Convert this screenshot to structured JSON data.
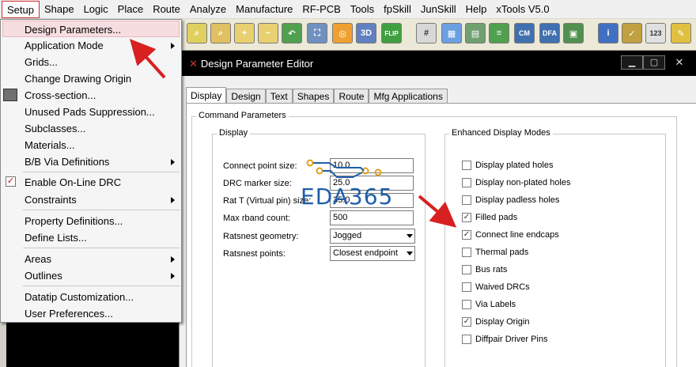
{
  "menubar": {
    "items": [
      "Setup",
      "Shape",
      "Logic",
      "Place",
      "Route",
      "Analyze",
      "Manufacture",
      "RF-PCB",
      "Tools",
      "fpSkill",
      "JunSkill",
      "Help",
      "xTools V5.0"
    ]
  },
  "toolbar": {
    "labels": [
      "3D",
      "FLIP",
      "CM",
      "DFA",
      "123"
    ]
  },
  "menu": {
    "items": [
      {
        "label": "Design Parameters...",
        "sub": false
      },
      {
        "label": "Application Mode",
        "sub": true
      },
      {
        "label": "Grids...",
        "sub": false
      },
      {
        "label": "Change Drawing Origin",
        "sub": false
      },
      {
        "label": "Cross-section...",
        "sub": false
      },
      {
        "label": "Unused Pads Suppression...",
        "sub": false
      },
      {
        "label": "Subclasses...",
        "sub": false
      },
      {
        "label": "Materials...",
        "sub": false
      },
      {
        "label": "B/B Via Definitions",
        "sub": true
      },
      {
        "label": "Enable On-Line DRC",
        "sub": false
      },
      {
        "label": "Constraints",
        "sub": true
      },
      {
        "label": "Property Definitions...",
        "sub": false
      },
      {
        "label": "Define Lists...",
        "sub": false
      },
      {
        "label": "Areas",
        "sub": true
      },
      {
        "label": "Outlines",
        "sub": true
      },
      {
        "label": "Datatip Customization...",
        "sub": false
      },
      {
        "label": "User Preferences...",
        "sub": false
      }
    ]
  },
  "dialog": {
    "title": "Design Parameter Editor",
    "tabs": [
      "Display",
      "Design",
      "Text",
      "Shapes",
      "Route",
      "Mfg Applications"
    ],
    "command_group": "Command Parameters",
    "display_group": "Display",
    "enhanced_group": "Enhanced Display Modes",
    "fields": [
      {
        "label": "Connect point size:",
        "value": "10.0"
      },
      {
        "label": "DRC marker size:",
        "value": "25.0"
      },
      {
        "label": "Rat T (Virtual pin) size:",
        "value": "35.0"
      },
      {
        "label": "Max rband count:",
        "value": "500"
      }
    ],
    "selects": [
      {
        "label": "Ratsnest geometry:",
        "value": "Jogged"
      },
      {
        "label": "Ratsnest points:",
        "value": "Closest endpoint"
      }
    ],
    "checkboxes": [
      {
        "label": "Display plated holes",
        "checked": false
      },
      {
        "label": "Display non-plated holes",
        "checked": false
      },
      {
        "label": "Display padless holes",
        "checked": false
      },
      {
        "label": "Filled pads",
        "checked": true
      },
      {
        "label": "Connect line endcaps",
        "checked": true
      },
      {
        "label": "Thermal pads",
        "checked": false
      },
      {
        "label": "Bus rats",
        "checked": false
      },
      {
        "label": "Waived DRCs",
        "checked": false
      },
      {
        "label": "Via Labels",
        "checked": false
      },
      {
        "label": "Display Origin",
        "checked": true
      },
      {
        "label": "Diffpair Driver Pins",
        "checked": false
      }
    ]
  },
  "watermark": "EDA365",
  "colors": {
    "accent_red": "#d82020",
    "menu_highlight": "#f6dde0",
    "watermark_blue": "#1e5fa8"
  }
}
